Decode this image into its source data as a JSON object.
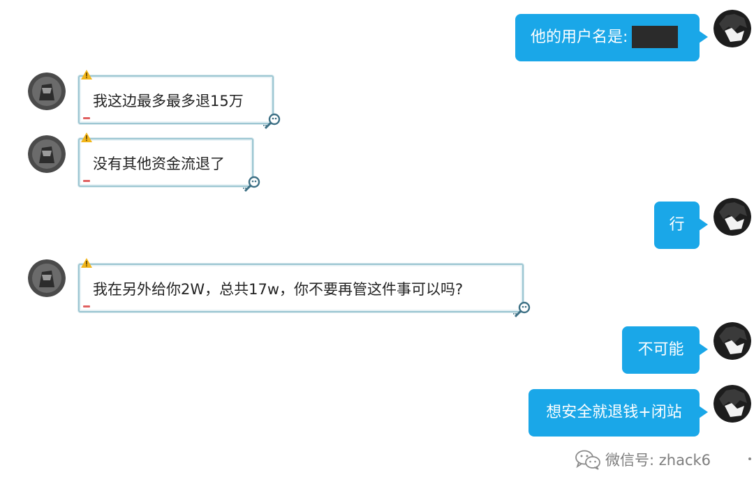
{
  "messages": [
    {
      "side": "out",
      "text": "他的用户名是:",
      "redacted": true
    },
    {
      "side": "in",
      "text": "我这边最多最多退15万"
    },
    {
      "side": "in",
      "text": "没有其他资金流退了"
    },
    {
      "side": "out",
      "text": "行"
    },
    {
      "side": "in",
      "text": "我在另外给你2W，总共17w，你不要再管这件事可以吗?"
    },
    {
      "side": "out",
      "text": "不可能"
    },
    {
      "side": "out",
      "text": "想安全就退钱+闭站"
    }
  ],
  "watermark": {
    "text": "微信号: zhack6"
  },
  "colors": {
    "outgoing_bubble": "#1aa7e8",
    "incoming_border": "#9cc6d2",
    "redaction": "#2b2b2b"
  },
  "icons": {
    "incoming_badge": "warning-icon",
    "incoming_action": "magnifier-icon",
    "watermark": "wechat-icon"
  }
}
